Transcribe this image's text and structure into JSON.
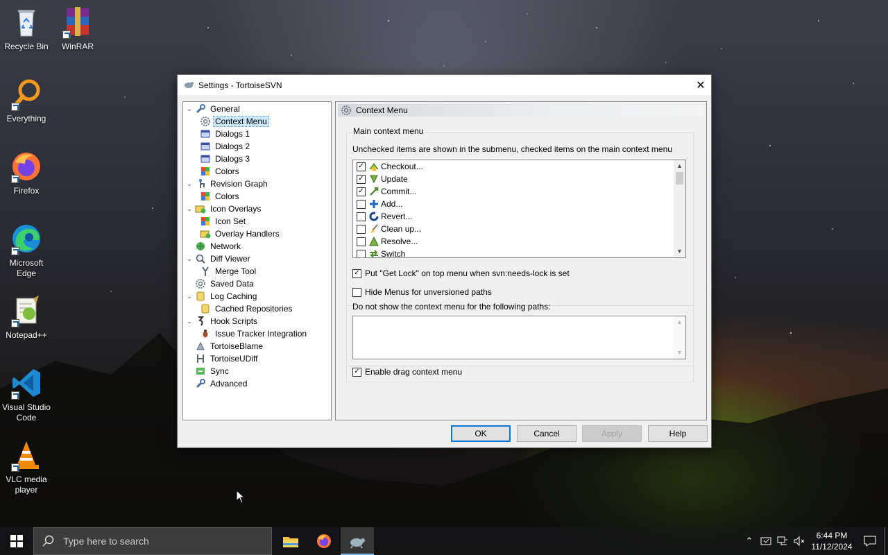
{
  "desktop": {
    "icons": [
      {
        "label": "Recycle Bin",
        "icon": "recycle-bin-icon"
      },
      {
        "label": "WinRAR",
        "icon": "winrar-icon"
      },
      {
        "label": "Everything",
        "icon": "everything-icon"
      },
      {
        "label": "Firefox",
        "icon": "firefox-icon"
      },
      {
        "label": "Microsoft Edge",
        "icon": "edge-icon"
      },
      {
        "label": "Notepad++",
        "icon": "notepadpp-icon"
      },
      {
        "label": "Visual Studio Code",
        "icon": "vscode-icon"
      },
      {
        "label": "VLC media player",
        "icon": "vlc-icon"
      }
    ]
  },
  "dialog": {
    "title": "Settings - TortoiseSVN",
    "tree": [
      {
        "label": "General",
        "level": 0,
        "expander": "open",
        "icon": "wrench-icon"
      },
      {
        "label": "Context Menu",
        "level": 1,
        "icon": "gear-icon",
        "selected": true
      },
      {
        "label": "Dialogs 1",
        "level": 1,
        "icon": "dialog-icon"
      },
      {
        "label": "Dialogs 2",
        "level": 1,
        "icon": "dialog-icon"
      },
      {
        "label": "Dialogs 3",
        "level": 1,
        "icon": "dialog-icon"
      },
      {
        "label": "Colors",
        "level": 1,
        "icon": "palette-icon"
      },
      {
        "label": "Revision Graph",
        "level": 0,
        "expander": "open",
        "icon": "graph-icon"
      },
      {
        "label": "Colors",
        "level": 1,
        "icon": "palette-icon"
      },
      {
        "label": "Icon Overlays",
        "level": 0,
        "expander": "open",
        "icon": "overlay-icon"
      },
      {
        "label": "Icon Set",
        "level": 1,
        "icon": "palette-icon"
      },
      {
        "label": "Overlay Handlers",
        "level": 1,
        "icon": "overlay-icon"
      },
      {
        "label": "Network",
        "level": 0,
        "icon": "network-icon"
      },
      {
        "label": "Diff Viewer",
        "level": 0,
        "expander": "open",
        "icon": "magnifier-icon"
      },
      {
        "label": "Merge Tool",
        "level": 1,
        "icon": "merge-icon"
      },
      {
        "label": "Saved Data",
        "level": 0,
        "icon": "gear-icon"
      },
      {
        "label": "Log Caching",
        "level": 0,
        "expander": "open",
        "icon": "database-icon"
      },
      {
        "label": "Cached Repositories",
        "level": 1,
        "icon": "database-icon"
      },
      {
        "label": "Hook Scripts",
        "level": 0,
        "expander": "open",
        "icon": "hook-icon"
      },
      {
        "label": "Issue Tracker Integration",
        "level": 1,
        "icon": "bug-icon"
      },
      {
        "label": "TortoiseBlame",
        "level": 0,
        "icon": "blame-icon"
      },
      {
        "label": "TortoiseUDiff",
        "level": 0,
        "icon": "udiff-icon"
      },
      {
        "label": "Sync",
        "level": 0,
        "icon": "sync-icon"
      },
      {
        "label": "Advanced",
        "level": 0,
        "icon": "wrench-icon"
      }
    ],
    "panel": {
      "header": "Context Menu",
      "group_title": "Main context menu",
      "note": "Unchecked items are shown in the submenu, checked items on the main context menu",
      "items": [
        {
          "label": "Checkout...",
          "checked": true,
          "icon": "checkout-icon"
        },
        {
          "label": "Update",
          "checked": true,
          "icon": "update-icon"
        },
        {
          "label": "Commit...",
          "checked": true,
          "icon": "commit-icon"
        },
        {
          "label": "Add...",
          "checked": false,
          "icon": "add-icon"
        },
        {
          "label": "Revert...",
          "checked": false,
          "icon": "revert-icon"
        },
        {
          "label": "Clean up...",
          "checked": false,
          "icon": "cleanup-icon"
        },
        {
          "label": "Resolve...",
          "checked": false,
          "icon": "resolve-icon"
        },
        {
          "label": "Switch",
          "checked": false,
          "icon": "switch-icon"
        }
      ],
      "get_lock_label": "Put \"Get Lock\" on top menu when svn:needs-lock is set",
      "get_lock_checked": true,
      "hide_menus_label": "Hide Menus for unversioned paths",
      "hide_menus_checked": false,
      "exclude_paths_label": "Do not show the context menu for the following paths:",
      "exclude_paths_value": "",
      "drag_menu_label": "Enable drag context menu",
      "drag_menu_checked": true
    },
    "buttons": {
      "ok": "OK",
      "cancel": "Cancel",
      "apply": "Apply",
      "help": "Help"
    }
  },
  "taskbar": {
    "search_placeholder": "Type here to search",
    "time": "6:44 PM",
    "date": "11/12/2024"
  }
}
